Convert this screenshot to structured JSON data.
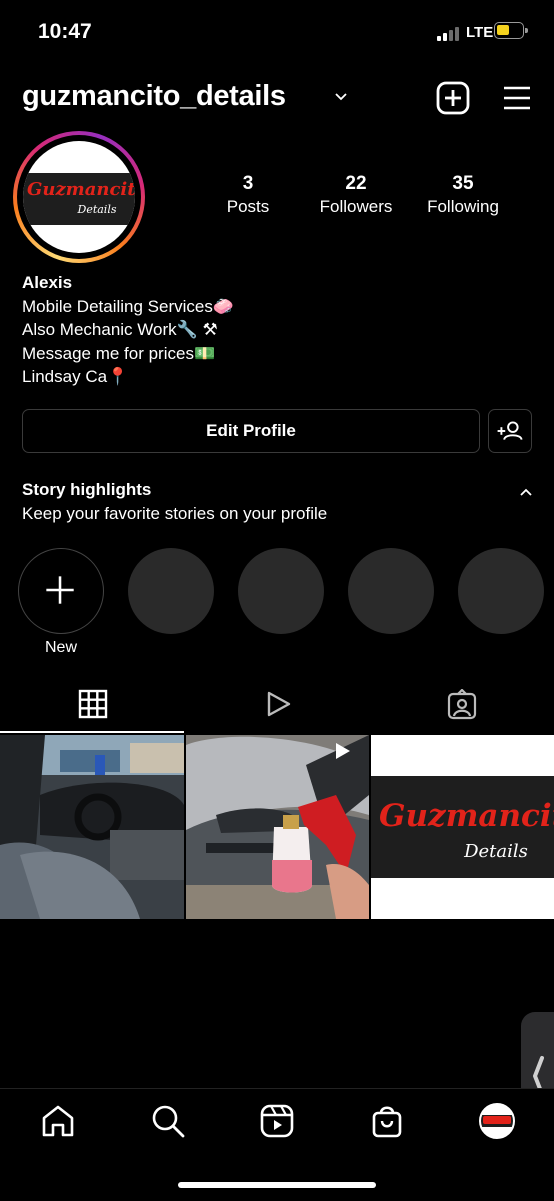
{
  "status_bar": {
    "time": "10:47",
    "network": "LTE"
  },
  "header": {
    "username": "guzmancito_details"
  },
  "avatar": {
    "logo_text": "Guzmancito",
    "logo_sub": "Details"
  },
  "stats": [
    {
      "value": "3",
      "label": "Posts"
    },
    {
      "value": "22",
      "label": "Followers"
    },
    {
      "value": "35",
      "label": "Following"
    }
  ],
  "bio": {
    "name": "Alexis",
    "lines": [
      "Mobile Detailing Services🧼",
      "Also Mechanic Work🔧 ⚒",
      "Message me for prices💵",
      "Lindsay Ca📍"
    ]
  },
  "buttons": {
    "edit_profile": "Edit Profile"
  },
  "highlights": {
    "title": "Story highlights",
    "subtitle": "Keep your favorite stories on your profile",
    "new_label": "New"
  },
  "posts": [
    {
      "icon": "car-interior-photo"
    },
    {
      "icon": "foam-cannon-car-wash-photo"
    },
    {
      "icon": "guzmancito-logo-image",
      "logo_text": "Guzmancito",
      "logo_sub": "Details"
    }
  ],
  "colors": {
    "background": "#000000",
    "text": "#ffffff",
    "logo_red": "#e2231a",
    "battery": "#f4d21e"
  }
}
